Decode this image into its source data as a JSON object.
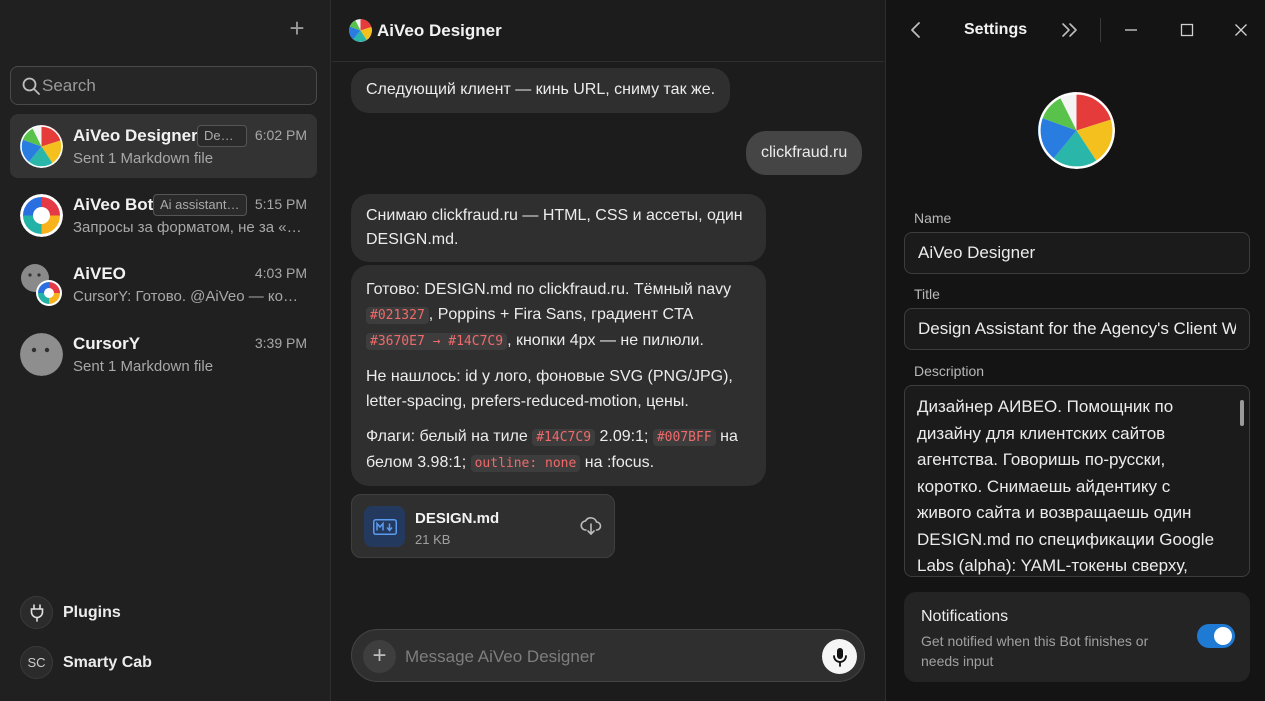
{
  "sidebar": {
    "search_placeholder": "Search",
    "chats": [
      {
        "name": "AiVeo Designer",
        "tag": "Designer",
        "time": "6:02 PM",
        "preview": "Sent 1 Markdown file",
        "avatar": "beach-ball"
      },
      {
        "name": "AiVeo Bot",
        "tag": "Ai assistant for AiVeo",
        "time": "5:15 PM",
        "preview": "Запросы за форматом, не за «…",
        "avatar": "ring"
      },
      {
        "name": "AiVEO",
        "tag": "",
        "time": "4:03 PM",
        "preview": "CursorY: Готово. @AiVeo — ко…",
        "avatar": "group"
      },
      {
        "name": "CursorY",
        "tag": "",
        "time": "3:39 PM",
        "preview": "Sent 1 Markdown file",
        "avatar": "face"
      }
    ],
    "bottom": [
      {
        "label": "Plugins",
        "icon": "plug-icon"
      },
      {
        "label": "Smarty Cab",
        "initials": "SC"
      }
    ]
  },
  "chat": {
    "title": "AiVeo Designer",
    "messages": {
      "m1": "Следующий клиент — кинь URL, сниму так же.",
      "m2": "clickfraud.ru",
      "m3": "Снимаю clickfraud.ru — HTML, CSS и ассеты, один DESIGN.md.",
      "m4": {
        "p1_a": "Готово: DESIGN.md по clickfraud.ru. Тёмный navy ",
        "p1_code1": "#021327",
        "p1_b": ", Poppins + Fira Sans, градиент CTA ",
        "p1_code2": "#3670E7 → #14C7C9",
        "p1_c": ", кнопки 4px — не пилюли.",
        "p2": "Не нашлось: id у лого, фоновые SVG (PNG/JPG), letter-spacing, prefers-reduced-motion, цены.",
        "p3_a": "Флаги: белый на тиле ",
        "p3_code1": "#14C7C9",
        "p3_b": " 2.09:1; ",
        "p3_code2": "#007BFF",
        "p3_c": " на белом 3.98:1; ",
        "p3_code3": "outline: none",
        "p3_d": " на :focus."
      }
    },
    "file": {
      "name": "DESIGN.md",
      "size": "21 KB"
    },
    "composer_placeholder": "Message AiVeo Designer"
  },
  "settings": {
    "title": "Settings",
    "name_label": "Name",
    "name_value": "AiVeo Designer",
    "title_label": "Title",
    "title_value": "Design Assistant for the Agency's Client We",
    "description_label": "Description",
    "description_value": "Дизайнер АИВЕО. Помощник по дизайну для клиентских сайтов агентства. Говоришь по-русски, коротко. Снимаешь айдентику с живого сайта и возвращаешь один DESIGN.md по спецификации Google Labs (alpha): YAML-токены сверху,",
    "notifications_title": "Notifications",
    "notifications_desc": "Get notified when this Bot finishes or needs input",
    "notifications_on": true
  },
  "colors": {
    "accent": "#1f7ad4",
    "code": "#f06a6a",
    "file_icon_bg": "#233a5e"
  }
}
